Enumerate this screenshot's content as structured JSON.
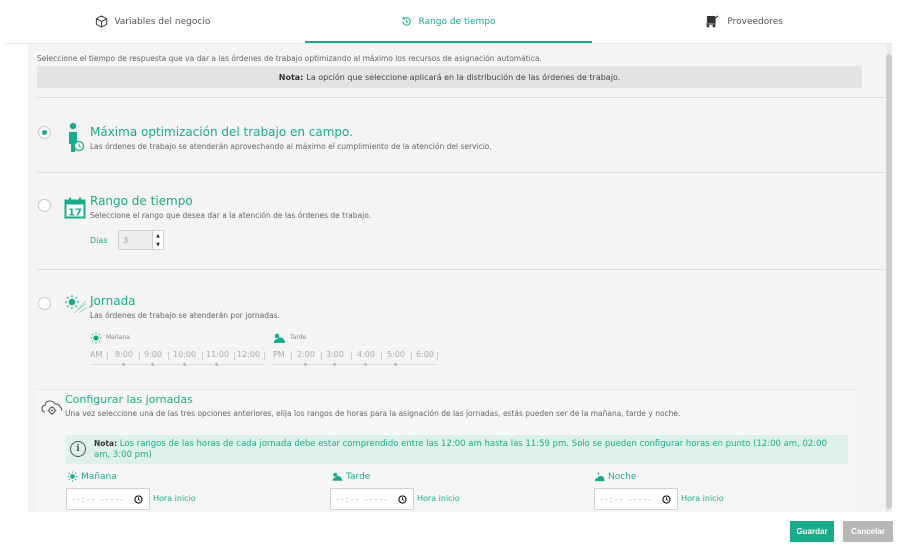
{
  "tabs": [
    {
      "label": "Variables del negocio",
      "icon": "cube-icon"
    },
    {
      "label": "Rango de tiempo",
      "icon": "history-icon",
      "active": true
    },
    {
      "label": "Proveedores",
      "icon": "cart-icon"
    }
  ],
  "intro": "Seleccione el tiempo de respuesta que va dar a las órdenes de trabajo optimizando al máximo los recursos de asignación automática.",
  "note": {
    "prefix": "Nota:",
    "text": "La opción que seleccione aplicará en la distribución de las órdenes de trabajo."
  },
  "options": {
    "max": {
      "title": "Máxima optimización del trabajo en campo.",
      "desc": "Las órdenes de trabajo se atenderán aprovechando al máximo el cumplimiento de la atención del servicio.",
      "checked": true
    },
    "range": {
      "title": "Rango de tiempo",
      "desc": "Seleccione el rango que desea dar a la atención de las órdenes de trabajo.",
      "calendar_day": "17",
      "dias_label": "Días",
      "dias_value": "3"
    },
    "jornada": {
      "title": "Jornada",
      "desc": "Las órdenes de trabajo se atenderán por jornadas."
    }
  },
  "timeline": {
    "morning_label": "Mañana",
    "afternoon_label": "Tarde",
    "am": "AM",
    "pm": "PM",
    "am_hours": [
      "8:00",
      "9:00",
      "10:00",
      "11:00",
      "12:00"
    ],
    "pm_hours": [
      "2:00",
      "3:00",
      "4:00",
      "5:00",
      "6:00"
    ]
  },
  "config": {
    "title": "Configurar las jornadas",
    "desc": "Una vez seleccione una de las tres opciones anteriores, elija los rangos de horas para la asignación de las jornadas, estás pueden ser de la mañana, tarde y noche.",
    "note_prefix": "Nota:",
    "note_text": "Los rangos de las horas de cada jornada debe estar comprendido entre las 12:00 am hasta las 11:59 pm. Solo se pueden configurar horas en punto (12:00 am, 02:00 am, 3:00 pm)",
    "shifts": [
      {
        "label": "Mañana",
        "placeholder": "--:-- -----",
        "hint": "Hora inicio"
      },
      {
        "label": "Tarde",
        "placeholder": "--:-- -----",
        "hint": "Hora inicio"
      },
      {
        "label": "Noche",
        "placeholder": "--:-- -----",
        "hint": "Hora inicio"
      }
    ]
  },
  "buttons": {
    "save": "Guardar",
    "cancel": "Cancelar"
  },
  "colors": {
    "accent": "#1aab8a",
    "panel": "#f4f4f4",
    "cancel": "#b7b7b7"
  }
}
